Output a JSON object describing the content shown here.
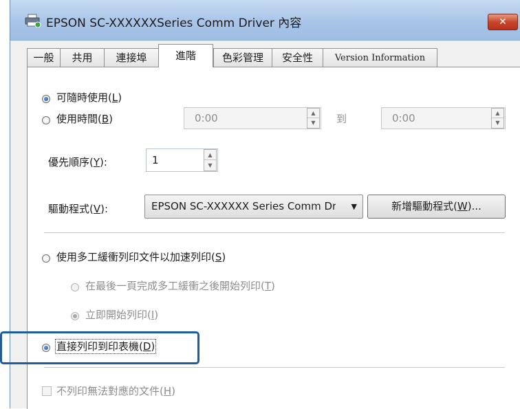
{
  "window": {
    "title": "EPSON SC-XXXXXXSeries Comm Driver 內容",
    "close_glyph": "✕"
  },
  "tabs": [
    {
      "label": "一般",
      "active": false
    },
    {
      "label": "共用",
      "active": false
    },
    {
      "label": "連接埠",
      "active": false
    },
    {
      "label": "進階",
      "active": true
    },
    {
      "label": "色彩管理",
      "active": false
    },
    {
      "label": "安全性",
      "active": false
    },
    {
      "label": "Version Information",
      "active": false
    }
  ],
  "availability": {
    "always_label": "可隨時使用(",
    "always_key": "L",
    "from_label": "使用時間(",
    "from_key": "B",
    "from_value": "0:00",
    "to_label": "到",
    "to_value": "0:00",
    "selected": "always"
  },
  "priority": {
    "label": "優先順序(",
    "key": "Y",
    "suffix": "):",
    "value": "1"
  },
  "driver": {
    "label": "驅動程式(",
    "key": "V",
    "suffix": "):",
    "value": "EPSON SC-XXXXXX Series Comm Driver",
    "new_button_label": "新增驅動程式(",
    "new_button_key": "W",
    "new_button_suffix": ")..."
  },
  "spool": {
    "spool_label": "使用多工緩衝列印文件以加速列印(",
    "spool_key": "S",
    "after_last_label": "在最後一頁完成多工緩衝之後開始列印(",
    "after_last_key": "T",
    "immediately_label": "立即開始列印(",
    "immediately_key": "I",
    "direct_label": "直接列印到印表機(",
    "direct_key": "D",
    "selected": "direct"
  },
  "hold_mismatched": {
    "label": "不列印無法對應的文件(",
    "key": "H",
    "checked": false
  },
  "colors": {
    "highlight": "#1f5c9e",
    "radio_dot": "#154e9c",
    "titlebar": "#a9c5e8",
    "close": "#c9452b"
  },
  "icons": [
    "printer-icon",
    "close-icon",
    "spin-up-icon",
    "spin-down-icon",
    "dropdown-arrow-icon"
  ]
}
